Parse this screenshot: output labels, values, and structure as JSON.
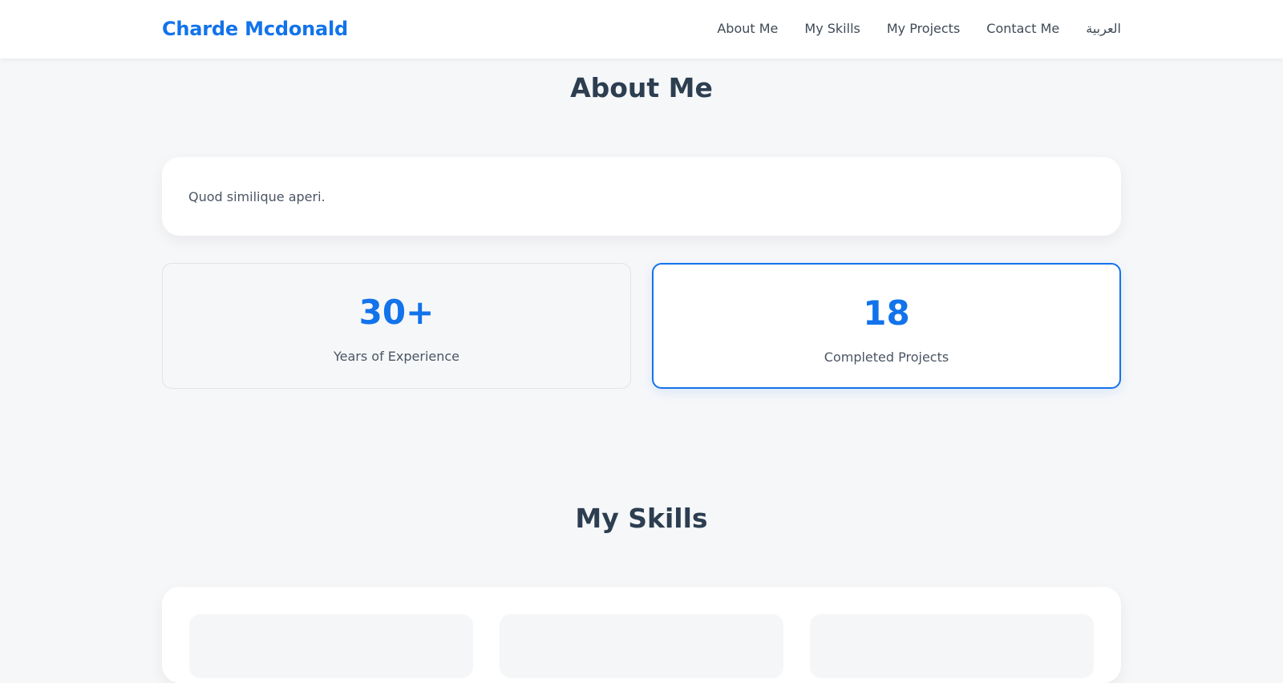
{
  "navbar": {
    "brand": "Charde Mcdonald",
    "links": [
      "About Me",
      "My Skills",
      "My Projects",
      "Contact Me",
      "العربية"
    ]
  },
  "about": {
    "title": "About Me",
    "text": "Quod similique aperi.",
    "stats": [
      {
        "number": "30+",
        "label": "Years of Experience"
      },
      {
        "number": "18",
        "label": "Completed Projects"
      }
    ]
  },
  "skills": {
    "title": "My Skills"
  },
  "colors": {
    "accent": "#1273eb",
    "heading": "#2c3e50",
    "background": "#f6f7f9"
  }
}
